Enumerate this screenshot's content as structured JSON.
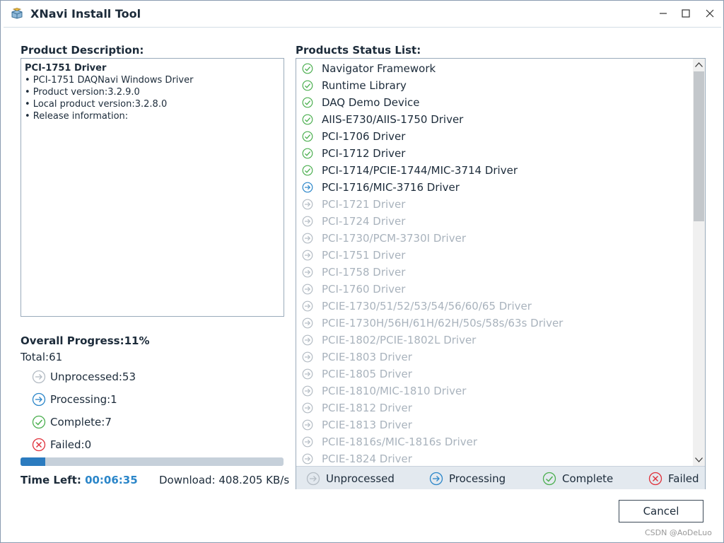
{
  "window": {
    "title": "XNavi Install Tool"
  },
  "description": {
    "label": "Product Description:",
    "title": "PCI-1751 Driver",
    "lines": [
      "• PCI-1751 DAQNavi Windows Driver",
      "• Product version:3.2.9.0",
      "• Local product version:3.2.8.0",
      "• Release information:"
    ]
  },
  "progress": {
    "label": "Overall Progress:",
    "percent_text": "11%",
    "fraction": 0.095,
    "total": "Total:61",
    "unprocessed": "Unprocessed:53",
    "processing": "Processing:1",
    "complete": "Complete:7",
    "failed": "Failed:0",
    "time_left_label": "Time Left:",
    "time_left": "00:06:35",
    "download": "Download: 408.205 KB/s"
  },
  "status_list": {
    "label": "Products Status List:",
    "items": [
      {
        "name": "Navigator Framework",
        "status": "complete"
      },
      {
        "name": "Runtime Library",
        "status": "complete"
      },
      {
        "name": "DAQ Demo Device",
        "status": "complete"
      },
      {
        "name": "AIIS-E730/AIIS-1750 Driver",
        "status": "complete"
      },
      {
        "name": "PCI-1706 Driver",
        "status": "complete"
      },
      {
        "name": "PCI-1712 Driver",
        "status": "complete"
      },
      {
        "name": "PCI-1714/PCIE-1744/MIC-3714 Driver",
        "status": "complete"
      },
      {
        "name": "PCI-1716/MIC-3716 Driver",
        "status": "processing"
      },
      {
        "name": "PCI-1721 Driver",
        "status": "unprocessed"
      },
      {
        "name": "PCI-1724 Driver",
        "status": "unprocessed"
      },
      {
        "name": "PCI-1730/PCM-3730I Driver",
        "status": "unprocessed"
      },
      {
        "name": "PCI-1751 Driver",
        "status": "unprocessed"
      },
      {
        "name": "PCI-1758 Driver",
        "status": "unprocessed"
      },
      {
        "name": "PCI-1760 Driver",
        "status": "unprocessed"
      },
      {
        "name": "PCIE-1730/51/52/53/54/56/60/65 Driver",
        "status": "unprocessed"
      },
      {
        "name": "PCIE-1730H/56H/61H/62H/50s/58s/63s Driver",
        "status": "unprocessed"
      },
      {
        "name": "PCIE-1802/PCIE-1802L Driver",
        "status": "unprocessed"
      },
      {
        "name": "PCIE-1803 Driver",
        "status": "unprocessed"
      },
      {
        "name": "PCIE-1805 Driver",
        "status": "unprocessed"
      },
      {
        "name": "PCIE-1810/MIC-1810 Driver",
        "status": "unprocessed"
      },
      {
        "name": "PCIE-1812 Driver",
        "status": "unprocessed"
      },
      {
        "name": "PCIE-1813 Driver",
        "status": "unprocessed"
      },
      {
        "name": "PCIE-1816s/MIC-1816s Driver",
        "status": "unprocessed"
      },
      {
        "name": "PCIE-1824 Driver",
        "status": "unprocessed"
      }
    ]
  },
  "legend": {
    "unprocessed": "Unprocessed",
    "processing": "Processing",
    "complete": "Complete",
    "failed": "Failed"
  },
  "buttons": {
    "cancel": "Cancel"
  },
  "watermark": "CSDN @AoDeLuo",
  "colors": {
    "complete": "#4caf50",
    "processing": "#2b86c9",
    "unprocessed": "#b4bcc4",
    "failed": "#e0303a",
    "progress_fill": "#2b7bbf"
  }
}
